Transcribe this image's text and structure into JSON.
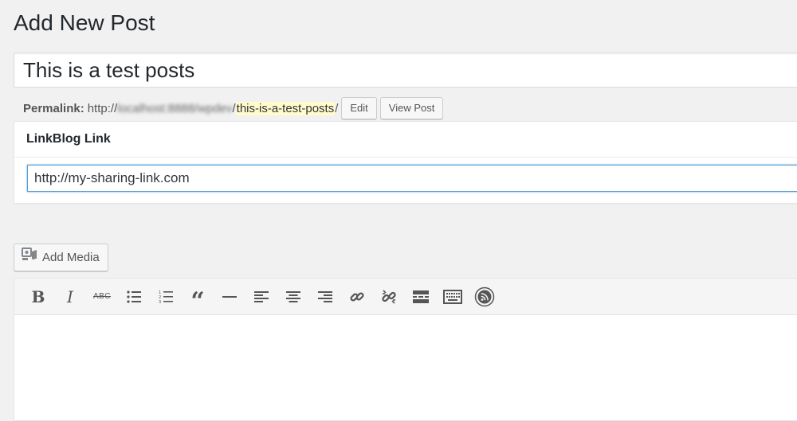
{
  "page": {
    "title": "Add New Post"
  },
  "post": {
    "title_value": "This is a test posts"
  },
  "permalink": {
    "label": "Permalink:",
    "prefix": "http://",
    "blurred_host": "localhost:8888/wpdev",
    "slug": "this-is-a-test-posts",
    "suffix": "/",
    "edit_label": "Edit",
    "view_label": "View Post",
    "slug_highlight_color": "#fffbcc"
  },
  "linkblog": {
    "header": "LinkBlog Link",
    "link_value": "http://my-sharing-link.com"
  },
  "media": {
    "add_media_label": "Add Media"
  },
  "toolbar": {
    "buttons": [
      {
        "icon": "bold-icon"
      },
      {
        "icon": "italic-icon"
      },
      {
        "icon": "strikethrough-icon"
      },
      {
        "icon": "bulleted-list-icon"
      },
      {
        "icon": "numbered-list-icon"
      },
      {
        "icon": "blockquote-icon"
      },
      {
        "icon": "horizontal-line-icon"
      },
      {
        "icon": "align-left-icon"
      },
      {
        "icon": "align-center-icon"
      },
      {
        "icon": "align-right-icon"
      },
      {
        "icon": "insert-link-icon"
      },
      {
        "icon": "remove-link-icon"
      },
      {
        "icon": "read-more-icon"
      },
      {
        "icon": "toolbar-toggle-icon"
      },
      {
        "icon": "rss-icon"
      }
    ]
  },
  "colors": {
    "background": "#f1f1f1",
    "focus_border": "#5b9dd9",
    "text": "#23282d"
  }
}
